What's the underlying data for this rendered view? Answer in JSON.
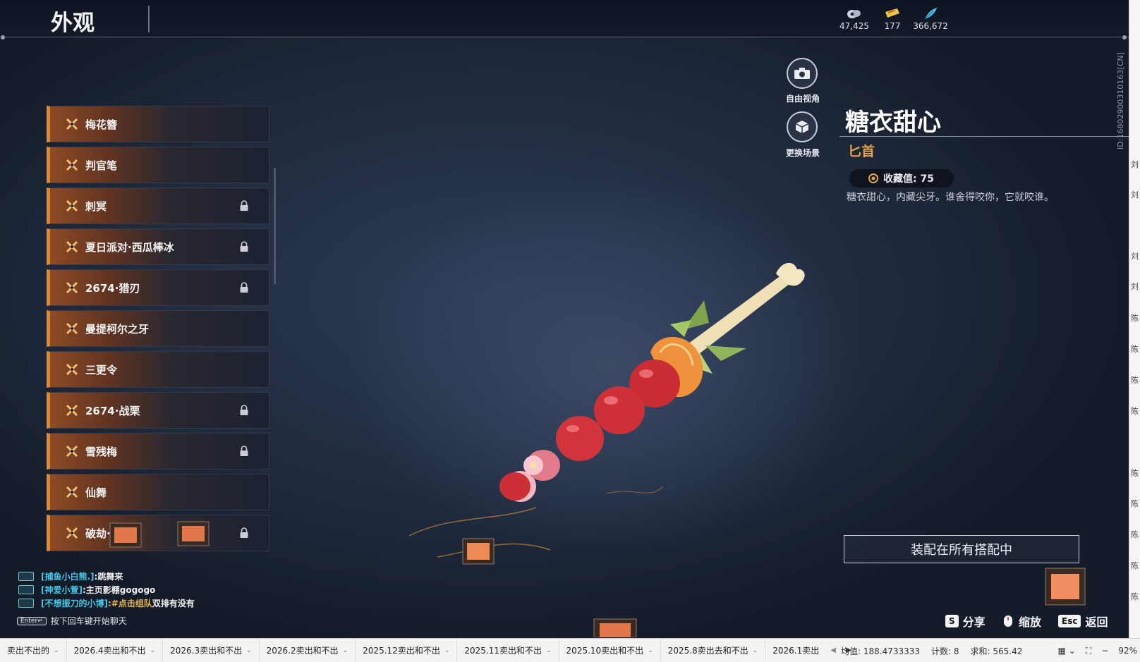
{
  "header": {
    "title": "外观"
  },
  "currencies": [
    {
      "icon": "cloud-coin-icon",
      "value": "47,425",
      "color": "#cfd6e2"
    },
    {
      "icon": "ticket-icon",
      "value": "177",
      "color": "#f0c44a"
    },
    {
      "icon": "feather-icon",
      "value": "366,672",
      "color": "#4cc0e8"
    }
  ],
  "list": {
    "items": [
      {
        "label": "梅花簪",
        "locked": false
      },
      {
        "label": "判官笔",
        "locked": false
      },
      {
        "label": "刺冥",
        "locked": true
      },
      {
        "label": "夏日派对·西瓜棒冰",
        "locked": true
      },
      {
        "label": "2674·猎刃",
        "locked": true
      },
      {
        "label": "曼提柯尔之牙",
        "locked": false
      },
      {
        "label": "三更令",
        "locked": false
      },
      {
        "label": "2674·战栗",
        "locked": true
      },
      {
        "label": "雪残梅",
        "locked": true
      },
      {
        "label": "仙舞",
        "locked": false
      },
      {
        "label": "破劫·千刃",
        "locked": true
      }
    ]
  },
  "view_controls": {
    "free_view": "自由视角",
    "change_scene": "更换场景"
  },
  "detail": {
    "name": "糖衣甜心",
    "type": "匕首",
    "collect_label": "收藏值: 75",
    "description": "糖衣甜心，内藏尖牙。谁舍得咬你，它就咬谁。",
    "equip_button": "装配在所有搭配中",
    "player_id": "ID:1680290031016​3[CN]"
  },
  "chat": {
    "messages": [
      {
        "name": "[捕鱼小白熊.]",
        "text": ":跳舞来",
        "link": ""
      },
      {
        "name": "[神爱小萱]",
        "text": ":主页影棚gogogo",
        "link": ""
      },
      {
        "name": "[不想振刀的小博]",
        "text": " 双排有没有",
        "link": ":#点击组队"
      }
    ],
    "enter_key": "Enter↵",
    "hint": "按下回车键开始聊天"
  },
  "hotkeys": [
    {
      "key": "S",
      "label": "分享"
    },
    {
      "key": "⎍",
      "label": "缩放"
    },
    {
      "key": "Esc",
      "label": "返回"
    }
  ],
  "sheetbar": {
    "tabs": [
      "卖出不出的",
      "2026.4卖出和不出",
      "2026.3卖出和不出",
      "2026.2卖出和不出",
      "2025.12卖出和不出",
      "2025.11卖出和不出",
      "2025.10卖出和不出",
      "2025.8卖出去和不出",
      "2026.1卖出"
    ],
    "avg": "均值: 188.4733333",
    "count": "计数: 8",
    "sum": "求和: 565.42",
    "zoom": "92%"
  },
  "right_strip_chars": [
    "刘",
    "刘",
    "刘",
    "刘",
    "陈",
    "陈",
    "陈",
    "陈",
    "陈",
    "陈",
    "陈",
    "陈",
    "陈"
  ]
}
